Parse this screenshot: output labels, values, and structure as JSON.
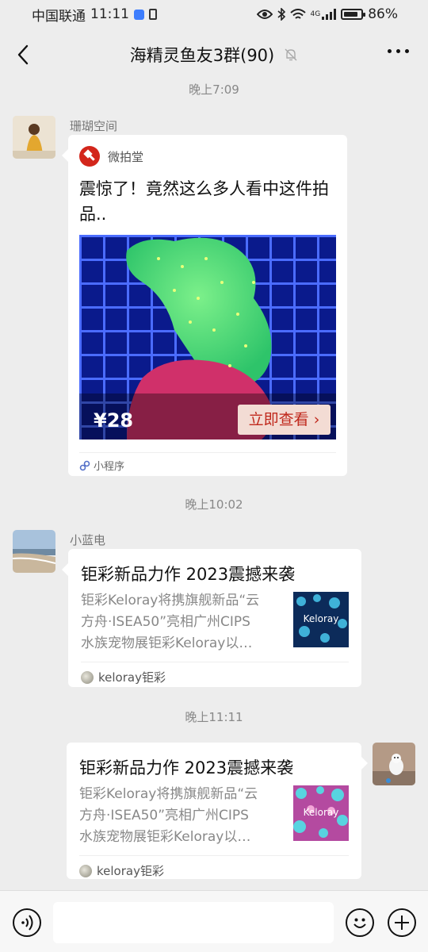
{
  "status_bar": {
    "carrier": "中国联通",
    "time": "11:11",
    "network": "4G",
    "battery": "86%",
    "battery_level": 0.86
  },
  "header": {
    "title": "海精灵鱼友3群(90)",
    "back_icon": "chevron-left-icon",
    "mute_icon": "bell-off-icon",
    "more_icon": "more-dots-icon"
  },
  "messages": [
    {
      "time": "晚上7:09",
      "sender": "珊瑚空间",
      "type": "mini-program",
      "app_name": "微拍堂",
      "title": "震惊了！竟然这么多人看中这件拍品..",
      "price": "¥28",
      "cta": "立即查看",
      "footer": "小程序"
    },
    {
      "time": "晚上10:02",
      "sender": "小蓝电",
      "type": "link",
      "title": "钜彩新品力作 2023震撼来袭",
      "desc_lines": [
        "钜彩Keloray将携旗舰新品“云",
        "方舟·ISEA50”亮相广州CIPS",
        "水族宠物展钜彩Keloray以…"
      ],
      "thumb_text": "Keloray",
      "source": "keloray钜彩"
    },
    {
      "time": "晚上11:11",
      "sender": "",
      "type": "link",
      "title": "钜彩新品力作 2023震撼来袭",
      "desc_lines": [
        "钜彩Keloray将携旗舰新品“云",
        "方舟·ISEA50”亮相广州CIPS",
        "水族宠物展钜彩Keloray以…"
      ],
      "thumb_text": "Keloray",
      "source": "keloray钜彩"
    }
  ],
  "input_bar": {
    "voice_icon": "voice-icon",
    "emoji_icon": "emoji-icon",
    "plus_icon": "plus-icon",
    "placeholder": ""
  }
}
